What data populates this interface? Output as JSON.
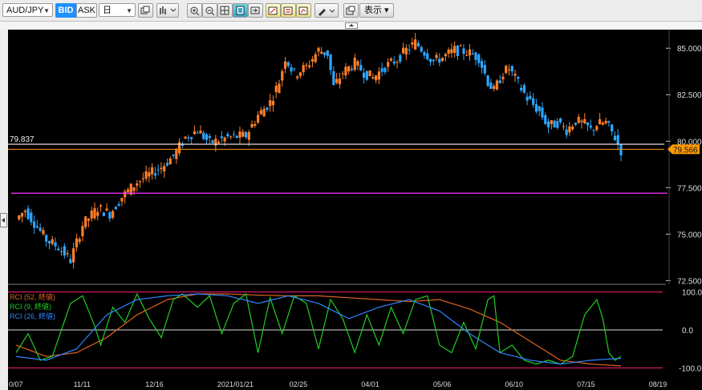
{
  "toolbar": {
    "symbol": "AUD/JPY",
    "bid_label": "BID",
    "ask_label": "ASK",
    "timeframe": "日",
    "display_label": "表示 ▾",
    "icons": [
      "copy-icon",
      "chart-type-icon",
      "zoom-in-icon",
      "zoom-out-icon",
      "fit-icon",
      "panel-icon",
      "scroll-end-icon",
      "draw-icon",
      "draw2-icon",
      "draw3-icon",
      "pen-icon",
      "window-icon"
    ]
  },
  "price_axis": {
    "ticks": [
      {
        "value": 85.0,
        "label": "85.000"
      },
      {
        "value": 82.5,
        "label": "82.500"
      },
      {
        "value": 80.0,
        "label": "80.000"
      },
      {
        "value": 77.5,
        "label": "77.500"
      },
      {
        "value": 75.0,
        "label": "75.000"
      },
      {
        "value": 72.5,
        "label": "72.500"
      }
    ],
    "current_price": "79.566",
    "current_price_value": 79.566
  },
  "lines": {
    "white_line_label": "79.837",
    "white_line_value": 79.837,
    "orange_line_value": 79.566,
    "magenta_line_value": 77.2
  },
  "rci_axis": {
    "ticks": [
      {
        "value": 100,
        "label": "100.0"
      },
      {
        "value": 0,
        "label": "0.0"
      },
      {
        "value": -100,
        "label": "-100.0"
      }
    ]
  },
  "rci_legend": [
    {
      "label": "RCI (52, 終値)",
      "color": "#e0641e"
    },
    {
      "label": "RCI (9, 終値)",
      "color": "#22cc22"
    },
    {
      "label": "RCI (26, 終値)",
      "color": "#2e86ff"
    }
  ],
  "x_axis": {
    "labels": [
      "0/07",
      "11/11",
      "12/16",
      "2021/01/21",
      "02/25",
      "04/01",
      "05/06",
      "06/10",
      "07/15",
      "08/19"
    ]
  },
  "colors": {
    "up": "#ff7f2a",
    "down": "#2ea6ff",
    "rci_line": "#ff1f7a",
    "magenta": "#ff33ff",
    "white_line": "#f2f2f2",
    "orange_line": "#ff9900"
  },
  "chart_data": {
    "type": "candlestick",
    "title": "AUD/JPY",
    "ylim": [
      72.3,
      86.0
    ],
    "close_keypoints": [
      [
        0,
        75.8
      ],
      [
        3,
        76.3
      ],
      [
        10,
        74.7
      ],
      [
        14,
        74.3
      ],
      [
        18,
        73.6
      ],
      [
        22,
        75.5
      ],
      [
        27,
        76.4
      ],
      [
        31,
        76.1
      ],
      [
        35,
        77.0
      ],
      [
        40,
        77.8
      ],
      [
        44,
        78.2
      ],
      [
        48,
        78.6
      ],
      [
        52,
        79.2
      ],
      [
        56,
        80.2
      ],
      [
        60,
        80.6
      ],
      [
        64,
        79.9
      ],
      [
        70,
        80.2
      ],
      [
        76,
        80.3
      ],
      [
        80,
        81.4
      ],
      [
        84,
        82.1
      ],
      [
        87,
        83.2
      ],
      [
        89,
        84.5
      ],
      [
        92,
        83.6
      ],
      [
        96,
        84.0
      ],
      [
        100,
        84.9
      ],
      [
        103,
        84.7
      ],
      [
        105,
        82.9
      ],
      [
        108,
        83.7
      ],
      [
        112,
        84.2
      ],
      [
        115,
        83.7
      ],
      [
        118,
        83.4
      ],
      [
        122,
        84.0
      ],
      [
        126,
        84.4
      ],
      [
        129,
        84.9
      ],
      [
        132,
        85.3
      ],
      [
        135,
        84.8
      ],
      [
        138,
        84.3
      ],
      [
        141,
        84.5
      ],
      [
        145,
        84.9
      ],
      [
        149,
        84.8
      ],
      [
        153,
        84.5
      ],
      [
        156,
        83.2
      ],
      [
        158,
        82.7
      ],
      [
        161,
        83.7
      ],
      [
        163,
        83.9
      ],
      [
        166,
        83.1
      ],
      [
        169,
        82.3
      ],
      [
        173,
        81.6
      ],
      [
        176,
        80.8
      ],
      [
        179,
        81.0
      ],
      [
        182,
        80.6
      ],
      [
        185,
        81.1
      ],
      [
        188,
        80.9
      ],
      [
        190,
        80.6
      ],
      [
        192,
        80.9
      ],
      [
        195,
        81.0
      ],
      [
        198,
        80.2
      ],
      [
        200,
        79.5
      ]
    ],
    "rci": {
      "series": [
        {
          "name": "RCI (52, 終値)",
          "keypoints": [
            [
              0,
              -40
            ],
            [
              10,
              -70
            ],
            [
              20,
              -60
            ],
            [
              30,
              -20
            ],
            [
              40,
              40
            ],
            [
              50,
              80
            ],
            [
              60,
              95
            ],
            [
              70,
              95
            ],
            [
              80,
              92
            ],
            [
              90,
              90
            ],
            [
              100,
              90
            ],
            [
              110,
              85
            ],
            [
              120,
              80
            ],
            [
              130,
              75
            ],
            [
              140,
              80
            ],
            [
              150,
              55
            ],
            [
              160,
              20
            ],
            [
              170,
              -30
            ],
            [
              180,
              -80
            ],
            [
              190,
              -90
            ],
            [
              200,
              -95
            ]
          ]
        },
        {
          "name": "RCI (9, 終値)",
          "keypoints": [
            [
              0,
              -60
            ],
            [
              4,
              -10
            ],
            [
              8,
              -80
            ],
            [
              12,
              -70
            ],
            [
              18,
              70
            ],
            [
              22,
              90
            ],
            [
              26,
              10
            ],
            [
              28,
              -40
            ],
            [
              32,
              60
            ],
            [
              36,
              20
            ],
            [
              40,
              95
            ],
            [
              44,
              30
            ],
            [
              48,
              -20
            ],
            [
              52,
              80
            ],
            [
              55,
              95
            ],
            [
              60,
              60
            ],
            [
              64,
              90
            ],
            [
              68,
              -10
            ],
            [
              72,
              70
            ],
            [
              76,
              95
            ],
            [
              80,
              -60
            ],
            [
              84,
              85
            ],
            [
              88,
              -10
            ],
            [
              92,
              90
            ],
            [
              96,
              70
            ],
            [
              100,
              -50
            ],
            [
              104,
              80
            ],
            [
              108,
              30
            ],
            [
              112,
              -60
            ],
            [
              116,
              40
            ],
            [
              120,
              -40
            ],
            [
              124,
              60
            ],
            [
              128,
              -10
            ],
            [
              132,
              80
            ],
            [
              136,
              90
            ],
            [
              140,
              -40
            ],
            [
              144,
              -60
            ],
            [
              148,
              20
            ],
            [
              152,
              -50
            ],
            [
              156,
              80
            ],
            [
              158,
              90
            ],
            [
              160,
              -60
            ],
            [
              164,
              -40
            ],
            [
              168,
              -80
            ],
            [
              172,
              -90
            ],
            [
              176,
              -80
            ],
            [
              180,
              -90
            ],
            [
              184,
              -70
            ],
            [
              188,
              40
            ],
            [
              192,
              80
            ],
            [
              194,
              30
            ],
            [
              196,
              -60
            ],
            [
              198,
              -80
            ],
            [
              200,
              -70
            ]
          ]
        },
        {
          "name": "RCI (26, 終値)",
          "keypoints": [
            [
              0,
              -70
            ],
            [
              10,
              -80
            ],
            [
              20,
              -50
            ],
            [
              30,
              40
            ],
            [
              40,
              80
            ],
            [
              50,
              90
            ],
            [
              60,
              95
            ],
            [
              70,
              90
            ],
            [
              80,
              70
            ],
            [
              90,
              90
            ],
            [
              100,
              70
            ],
            [
              110,
              30
            ],
            [
              120,
              60
            ],
            [
              130,
              80
            ],
            [
              140,
              50
            ],
            [
              150,
              -10
            ],
            [
              160,
              -60
            ],
            [
              170,
              -80
            ],
            [
              180,
              -90
            ],
            [
              190,
              -80
            ],
            [
              200,
              -75
            ]
          ]
        }
      ],
      "ylim": [
        -112,
        112
      ]
    }
  }
}
